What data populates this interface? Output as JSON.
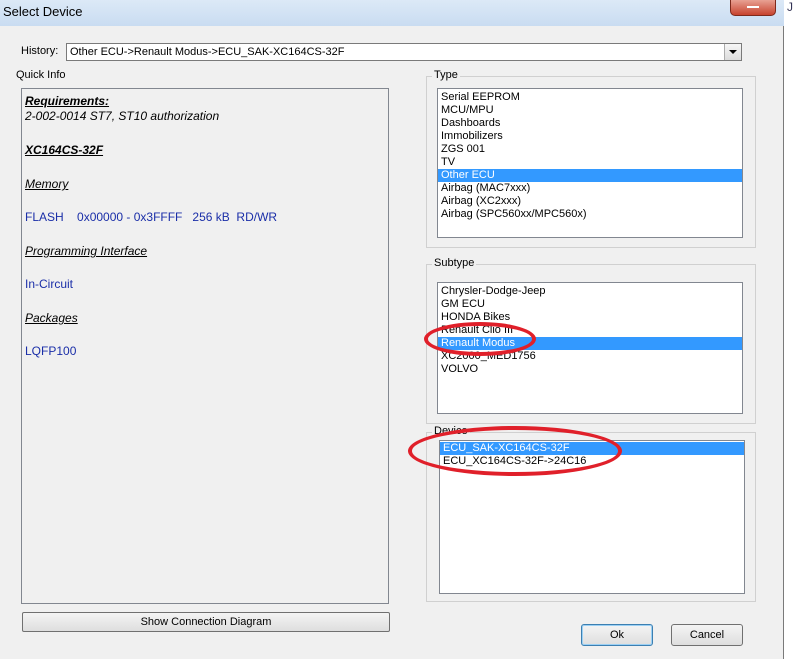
{
  "window": {
    "title": "Select Device",
    "corner_mark": "J"
  },
  "history": {
    "label": "History:",
    "value": "Other ECU->Renault Modus->ECU_SAK-XC164CS-32F"
  },
  "quick_info": {
    "label": "Quick Info",
    "requirements_heading": "Requirements:",
    "requirements_text": "2-002-0014  ST7, ST10 authorization",
    "device_heading": "XC164CS-32F",
    "memory_heading": "Memory",
    "memory_value": "FLASH    0x00000 - 0x3FFFF   256 kB  RD/WR",
    "interface_heading": "Programming Interface",
    "interface_value": "In-Circuit",
    "packages_heading": "Packages",
    "packages_value": "LQFP100"
  },
  "connection_button": "Show Connection Diagram",
  "type": {
    "label": "Type",
    "items": [
      "Serial EEPROM",
      "MCU/MPU",
      "Dashboards",
      "Immobilizers",
      "ZGS 001",
      "TV",
      "Other ECU",
      "Airbag (MAC7xxx)",
      "Airbag (XC2xxx)",
      "Airbag (SPC560xx/MPC560x)"
    ],
    "selected": "Other ECU"
  },
  "subtype": {
    "label": "Subtype",
    "items": [
      "Chrysler-Dodge-Jeep",
      "GM ECU",
      "HONDA Bikes",
      "Renault Clio III",
      "Renault Modus",
      "XC2000_MED1756",
      "VOLVO"
    ],
    "selected": "Renault Modus"
  },
  "device": {
    "label": "Device",
    "items": [
      "ECU_SAK-XC164CS-32F",
      "ECU_XC164CS-32F->24C16"
    ],
    "selected": "ECU_SAK-XC164CS-32F"
  },
  "buttons": {
    "ok": "Ok",
    "cancel": "Cancel"
  },
  "colors": {
    "selection": "#3399ff",
    "highlight_ring": "#e0202a",
    "info_text": "#1a2ea8"
  }
}
